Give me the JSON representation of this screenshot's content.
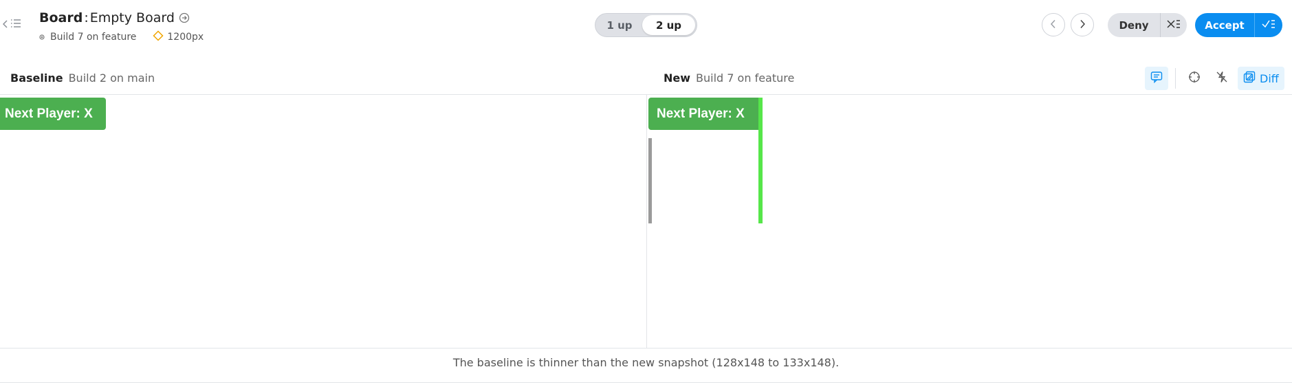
{
  "header": {
    "component": "Board",
    "separator": ":",
    "story": "Empty Board",
    "build": "Build 7 on feature",
    "viewport": "1200px"
  },
  "view_toggle": {
    "one_up": "1 up",
    "two_up": "2 up",
    "selected": "2 up"
  },
  "actions": {
    "deny": "Deny",
    "accept": "Accept"
  },
  "baseline": {
    "label": "Baseline",
    "build": "Build 2 on main",
    "banner": "Next Player: X"
  },
  "new": {
    "label": "New",
    "build": "Build 7 on feature",
    "banner": "Next Player: X"
  },
  "tools": {
    "diff": "Diff"
  },
  "footer": {
    "message": "The baseline is thinner than the new snapshot (128x148 to 133x148)."
  },
  "colors": {
    "accent": "#0a8df0",
    "banner": "#4caf50",
    "diff_highlight": "#56e64a",
    "viewport_icon": "#f0a500"
  },
  "icons": [
    "chevron-left-icon",
    "list-icon",
    "arrow-circle-right-icon",
    "dot-icon",
    "diamond-icon",
    "chevron-right-icon",
    "x-list-icon",
    "check-list-icon",
    "comment-icon",
    "crosshair-icon",
    "strike-lightning-icon",
    "diff-icon"
  ]
}
